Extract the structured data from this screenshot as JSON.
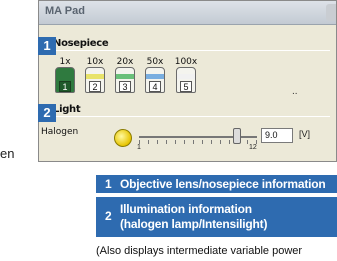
{
  "window": {
    "title": "MA Pad"
  },
  "nosepiece": {
    "heading": "Nosepiece",
    "objectives": [
      {
        "mag": "1x",
        "number": "1",
        "color": "#2f7a3f",
        "active": true
      },
      {
        "mag": "10x",
        "number": "2",
        "color": "#e8e36a",
        "active": false
      },
      {
        "mag": "20x",
        "number": "3",
        "color": "#69c07a",
        "active": false
      },
      {
        "mag": "50x",
        "number": "4",
        "color": "#79aee0",
        "active": false
      },
      {
        "mag": "100x",
        "number": "5",
        "color": "#f1f1f1",
        "active": false
      }
    ],
    "more": ".."
  },
  "light": {
    "heading": "Light",
    "lamp_label": "Halogen",
    "slider_min": "1",
    "slider_max": "12",
    "slider_value_fraction": 0.83,
    "value": "9.0",
    "unit": "[V]"
  },
  "markers": {
    "one": "1",
    "two": "2"
  },
  "left_fragment": "en",
  "captions": [
    {
      "number": "1",
      "text": "Objective lens/nosepiece information"
    },
    {
      "number": "2",
      "line1": "Illumination information",
      "line2": "(halogen lamp/Intensilight)"
    }
  ],
  "footnote": "(Also displays intermediate variable power"
}
